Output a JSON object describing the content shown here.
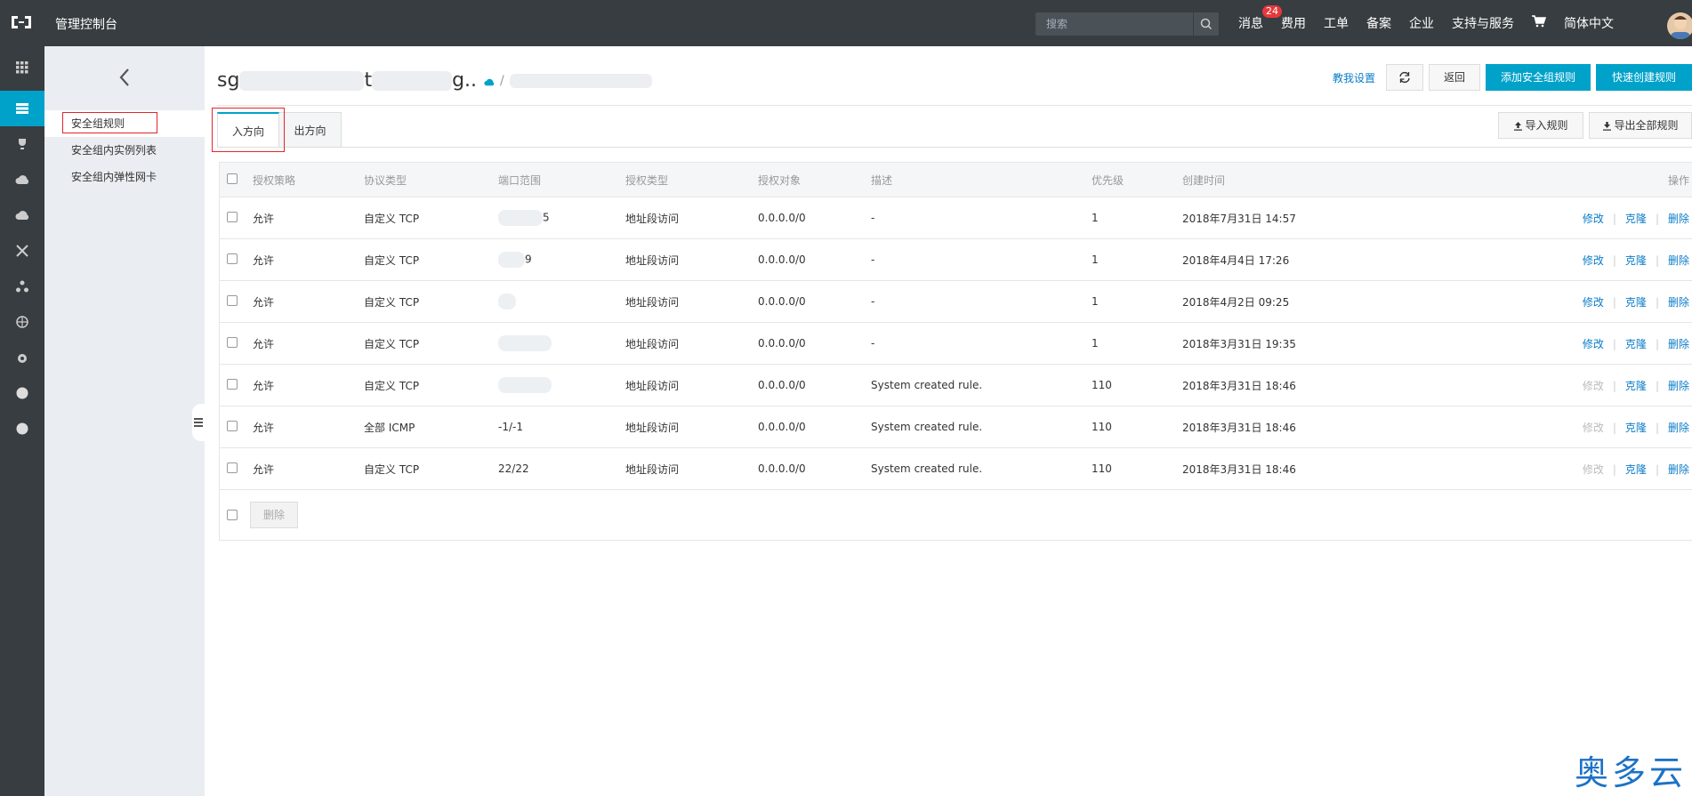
{
  "topbar": {
    "console_title": "管理控制台",
    "search_placeholder": "搜索",
    "nav": [
      {
        "label": "消息",
        "badge": "24"
      },
      {
        "label": "费用"
      },
      {
        "label": "工单"
      },
      {
        "label": "备案"
      },
      {
        "label": "企业"
      },
      {
        "label": "支持与服务"
      },
      {
        "label": "cart-icon"
      },
      {
        "label": "简体中文"
      }
    ]
  },
  "sidebar": {
    "items": [
      "安全组规则",
      "安全组内实例列表",
      "安全组内弹性网卡"
    ]
  },
  "breadcrumb": {
    "prefix": "sg",
    "mid": "t",
    "trail": "g.."
  },
  "header_actions": {
    "teach_link": "教我设置",
    "back": "返回",
    "add_rule": "添加安全组规则",
    "quick_create": "快速创建规则"
  },
  "tabs": {
    "inbound": "入方向",
    "outbound": "出方向",
    "import": "导入规则",
    "export": "导出全部规则"
  },
  "table": {
    "headers": [
      "授权策略",
      "协议类型",
      "端口范围",
      "授权类型",
      "授权对象",
      "描述",
      "优先级",
      "创建时间",
      "操作"
    ],
    "rows": [
      {
        "policy": "允许",
        "protocol": "自定义 TCP",
        "port": "5",
        "auth_type": "地址段访问",
        "object": "0.0.0.0/0",
        "desc": "-",
        "priority": "1",
        "time": "2018年7月31日 14:57",
        "edit_enabled": true
      },
      {
        "policy": "允许",
        "protocol": "自定义 TCP",
        "port": "9",
        "auth_type": "地址段访问",
        "object": "0.0.0.0/0",
        "desc": "-",
        "priority": "1",
        "time": "2018年4月4日 17:26",
        "edit_enabled": true
      },
      {
        "policy": "允许",
        "protocol": "自定义 TCP",
        "port": "",
        "auth_type": "地址段访问",
        "object": "0.0.0.0/0",
        "desc": "-",
        "priority": "1",
        "time": "2018年4月2日 09:25",
        "edit_enabled": true
      },
      {
        "policy": "允许",
        "protocol": "自定义 TCP",
        "port": "",
        "auth_type": "地址段访问",
        "object": "0.0.0.0/0",
        "desc": "-",
        "priority": "1",
        "time": "2018年3月31日 19:35",
        "edit_enabled": true
      },
      {
        "policy": "允许",
        "protocol": "自定义 TCP",
        "port": "",
        "auth_type": "地址段访问",
        "object": "0.0.0.0/0",
        "desc": "System created rule.",
        "priority": "110",
        "time": "2018年3月31日 18:46",
        "edit_enabled": false
      },
      {
        "policy": "允许",
        "protocol": "全部 ICMP",
        "port": "-1/-1",
        "auth_type": "地址段访问",
        "object": "0.0.0.0/0",
        "desc": "System created rule.",
        "priority": "110",
        "time": "2018年3月31日 18:46",
        "edit_enabled": false
      },
      {
        "policy": "允许",
        "protocol": "自定义 TCP",
        "port": "22/22",
        "auth_type": "地址段访问",
        "object": "0.0.0.0/0",
        "desc": "System created rule.",
        "priority": "110",
        "time": "2018年3月31日 18:46",
        "edit_enabled": false
      }
    ],
    "op_edit": "修改",
    "op_clone": "克隆",
    "op_delete": "删除",
    "bulk_delete": "删除"
  },
  "watermark": "奥多云",
  "colors": {
    "accent": "#00a2ca",
    "topbar": "#373d41",
    "link": "#0a7cc8",
    "highlight_box": "#e0262a"
  }
}
